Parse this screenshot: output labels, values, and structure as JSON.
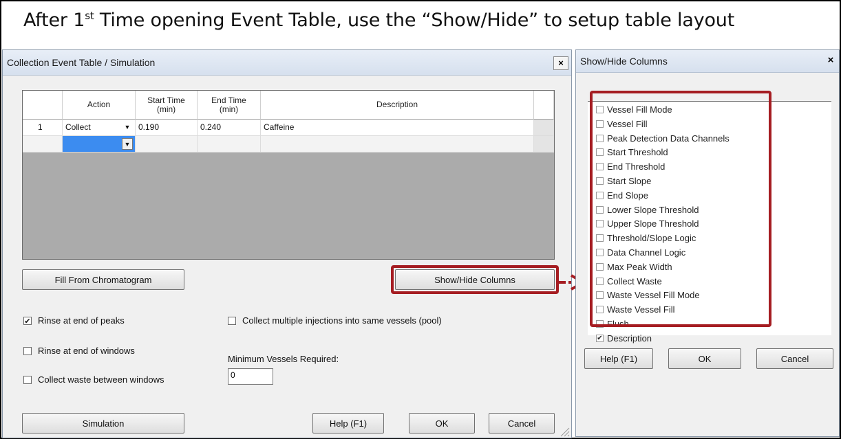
{
  "headline": {
    "before": "After 1",
    "sup": "st",
    "after": " Time opening  Event Table,  use the “Show/Hide” to setup table layout"
  },
  "main_dialog": {
    "title": "Collection Event Table / Simulation",
    "close": "×",
    "table": {
      "headers": [
        "",
        "Action",
        "Start Time\n(min)",
        "End Time\n(min)",
        "Description"
      ],
      "rows": [
        {
          "num": "1",
          "action": "Collect",
          "start": "0.190",
          "end": "0.240",
          "description": "Caffeine"
        }
      ]
    },
    "fill_button": "Fill From Chromatogram",
    "show_hide_button": "Show/Hide Columns",
    "checkboxes": [
      {
        "label": "Rinse at end of peaks",
        "checked": true
      },
      {
        "label": "Rinse at end of windows",
        "checked": false
      },
      {
        "label": "Collect waste between windows",
        "checked": false
      },
      {
        "label": "Collect multiple injections into same vessels (pool)",
        "checked": false
      }
    ],
    "min_vessels_label": "Minimum Vessels Required:",
    "min_vessels_value": "0",
    "simulation_button": "Simulation",
    "help_button": "Help (F1)",
    "ok_button": "OK",
    "cancel_button": "Cancel"
  },
  "side_dialog": {
    "title": "Show/Hide Columns",
    "close": "×",
    "columns": [
      {
        "label": "Vessel Fill Mode",
        "checked": false
      },
      {
        "label": "Vessel Fill",
        "checked": false
      },
      {
        "label": "Peak Detection Data Channels",
        "checked": false
      },
      {
        "label": "Start Threshold",
        "checked": false
      },
      {
        "label": "End Threshold",
        "checked": false
      },
      {
        "label": "Start Slope",
        "checked": false
      },
      {
        "label": "End Slope",
        "checked": false
      },
      {
        "label": "Lower Slope Threshold",
        "checked": false
      },
      {
        "label": "Upper Slope Threshold",
        "checked": false
      },
      {
        "label": "Threshold/Slope Logic",
        "checked": false
      },
      {
        "label": "Data Channel Logic",
        "checked": false
      },
      {
        "label": "Max Peak Width",
        "checked": false
      },
      {
        "label": "Collect Waste",
        "checked": false
      },
      {
        "label": "Waste Vessel Fill Mode",
        "checked": false
      },
      {
        "label": "Waste Vessel Fill",
        "checked": false
      },
      {
        "label": "Flush",
        "checked": false
      },
      {
        "label": "Description",
        "checked": true
      }
    ],
    "help_button": "Help (F1)",
    "ok_button": "OK",
    "cancel_button": "Cancel"
  },
  "colors": {
    "highlight": "#a51d22",
    "selected_cell": "#3c8cf0"
  }
}
